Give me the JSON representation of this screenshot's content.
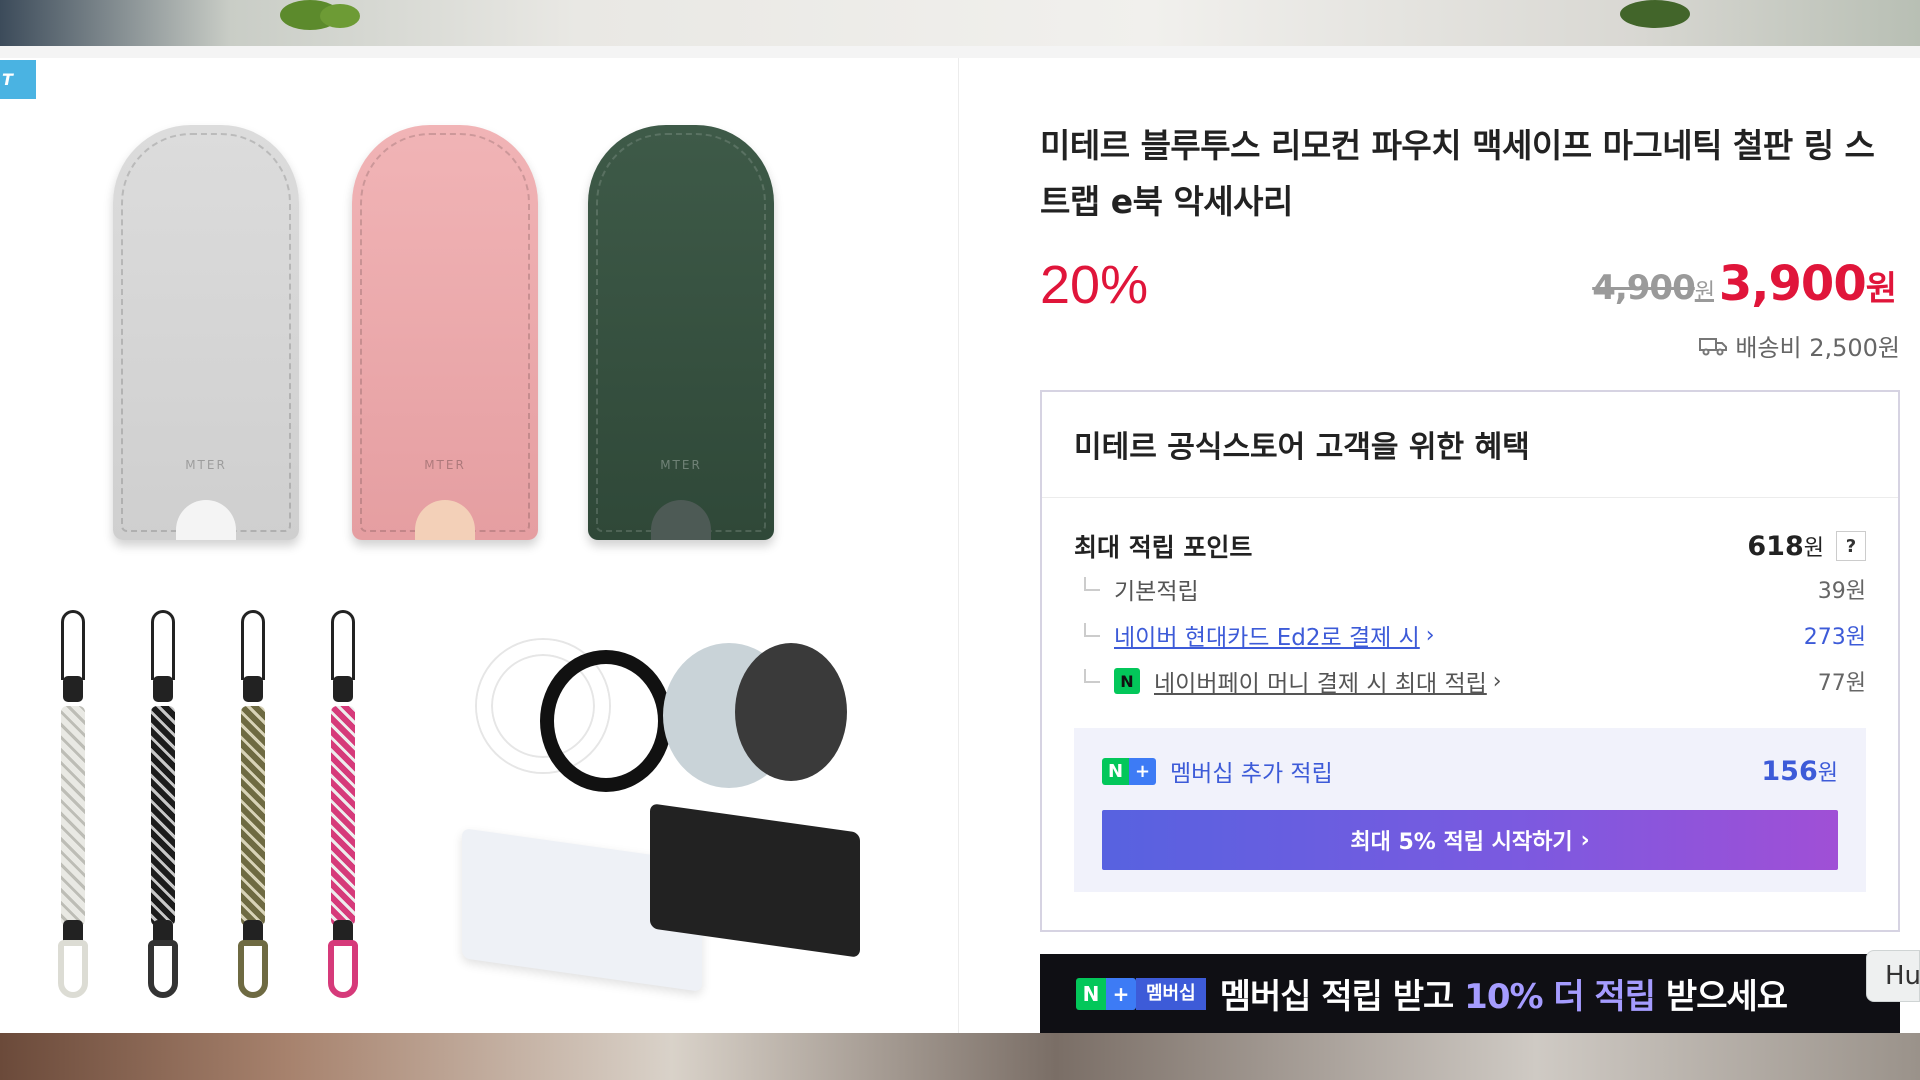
{
  "colors": {
    "accent_red": "#e0153a",
    "link_blue": "#3d5bd8",
    "naver_green": "#03c75a",
    "banner_bg": "#0f0f14"
  },
  "left": {
    "tag": "T"
  },
  "product": {
    "title": "미테르 블루투스 리모컨 파우치 맥세이프 마그네틱 철판 링 스트랩 e북 악세사리",
    "discount": "20%",
    "original_price": "4,900",
    "original_unit": "원",
    "sale_price": "3,900",
    "sale_unit": "원",
    "shipping": "배송비 2,500원"
  },
  "benefit": {
    "heading": "미테르 공식스토어 고객을 위한 혜택",
    "max_points_label": "최대 적립 포인트",
    "max_points_value": "618",
    "max_points_unit": "원",
    "help": "?",
    "items": [
      {
        "label": "기본적립",
        "value": "39원"
      },
      {
        "label": "네이버 현대카드 Ed2로 결제 시",
        "value": "273원"
      },
      {
        "label": "네이버페이 머니 결제 시 최대 적립",
        "value": "77원"
      }
    ],
    "npay_badge": "N",
    "membership": {
      "label": "멤버십 추가 적립",
      "value": "156",
      "unit": "원",
      "button": "최대 5% 적립 시작하기",
      "n": "N",
      "plus": "+"
    }
  },
  "banner": {
    "chip": "멤버십",
    "text_before": "멤버십 적립 받고 ",
    "text_highlight": "10% 더 적립",
    "text_after": " 받으세요",
    "close": "×"
  },
  "side_tab": "Hu"
}
